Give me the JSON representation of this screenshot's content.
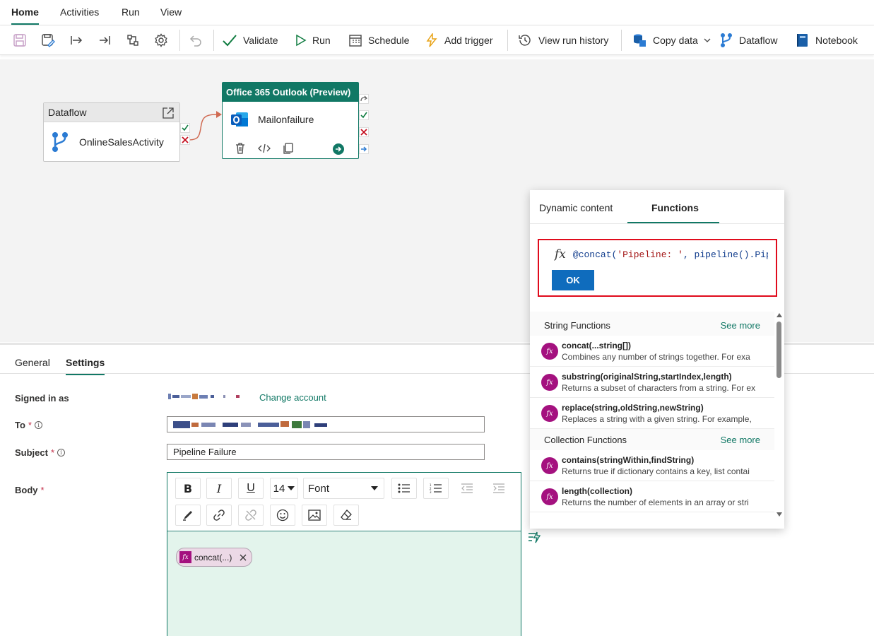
{
  "menu": {
    "tabs": [
      {
        "label": "Home",
        "active": true
      },
      {
        "label": "Activities"
      },
      {
        "label": "Run"
      },
      {
        "label": "View"
      }
    ]
  },
  "toolbar": {
    "validate": "Validate",
    "run": "Run",
    "schedule": "Schedule",
    "add_trigger": "Add trigger",
    "view_run_history": "View run history",
    "copy_data": "Copy data",
    "dataflow": "Dataflow",
    "notebook": "Notebook"
  },
  "canvas": {
    "dataflow_node": {
      "type": "Dataflow",
      "name": "OnlineSalesActivity"
    },
    "outlook_node": {
      "type": "Office 365 Outlook (Preview)",
      "name": "Mailonfailure"
    }
  },
  "bottom": {
    "tabs": [
      "General",
      "Settings"
    ],
    "active_tab": "Settings",
    "signed_in_label": "Signed in as",
    "change_account": "Change account",
    "to_label": "To",
    "subject_label": "Subject",
    "subject_value": "Pipeline Failure",
    "body_label": "Body",
    "font_size": "14",
    "font_family": "Font",
    "chip_label": "concat(...)"
  },
  "functions_panel": {
    "tabs": [
      "Dynamic content",
      "Functions"
    ],
    "active_tab": "Functions",
    "expression_prefix": "@concat(",
    "expression_string": "'Pipeline: '",
    "expression_rest": ", pipeline().Pip",
    "ok_label": "OK",
    "sections": [
      {
        "title": "String Functions",
        "see_more": "See more",
        "items": [
          {
            "name": "concat(...string[])",
            "desc": "Combines any number of strings together. For exa"
          },
          {
            "name": "substring(originalString,startIndex,length)",
            "desc": "Returns a subset of characters from a string. For ex"
          },
          {
            "name": "replace(string,oldString,newString)",
            "desc": "Replaces a string with a given string. For example,"
          }
        ]
      },
      {
        "title": "Collection Functions",
        "see_more": "See more",
        "items": [
          {
            "name": "contains(stringWithin,findString)",
            "desc": "Returns true if dictionary contains a key, list contai"
          },
          {
            "name": "length(collection)",
            "desc": "Returns the number of elements in an array or stri"
          }
        ]
      }
    ]
  },
  "colors": {
    "accent": "#117865",
    "fx": "#a4117f",
    "ok_button": "#0f6cbd",
    "highlight_border": "#e00b1c"
  }
}
